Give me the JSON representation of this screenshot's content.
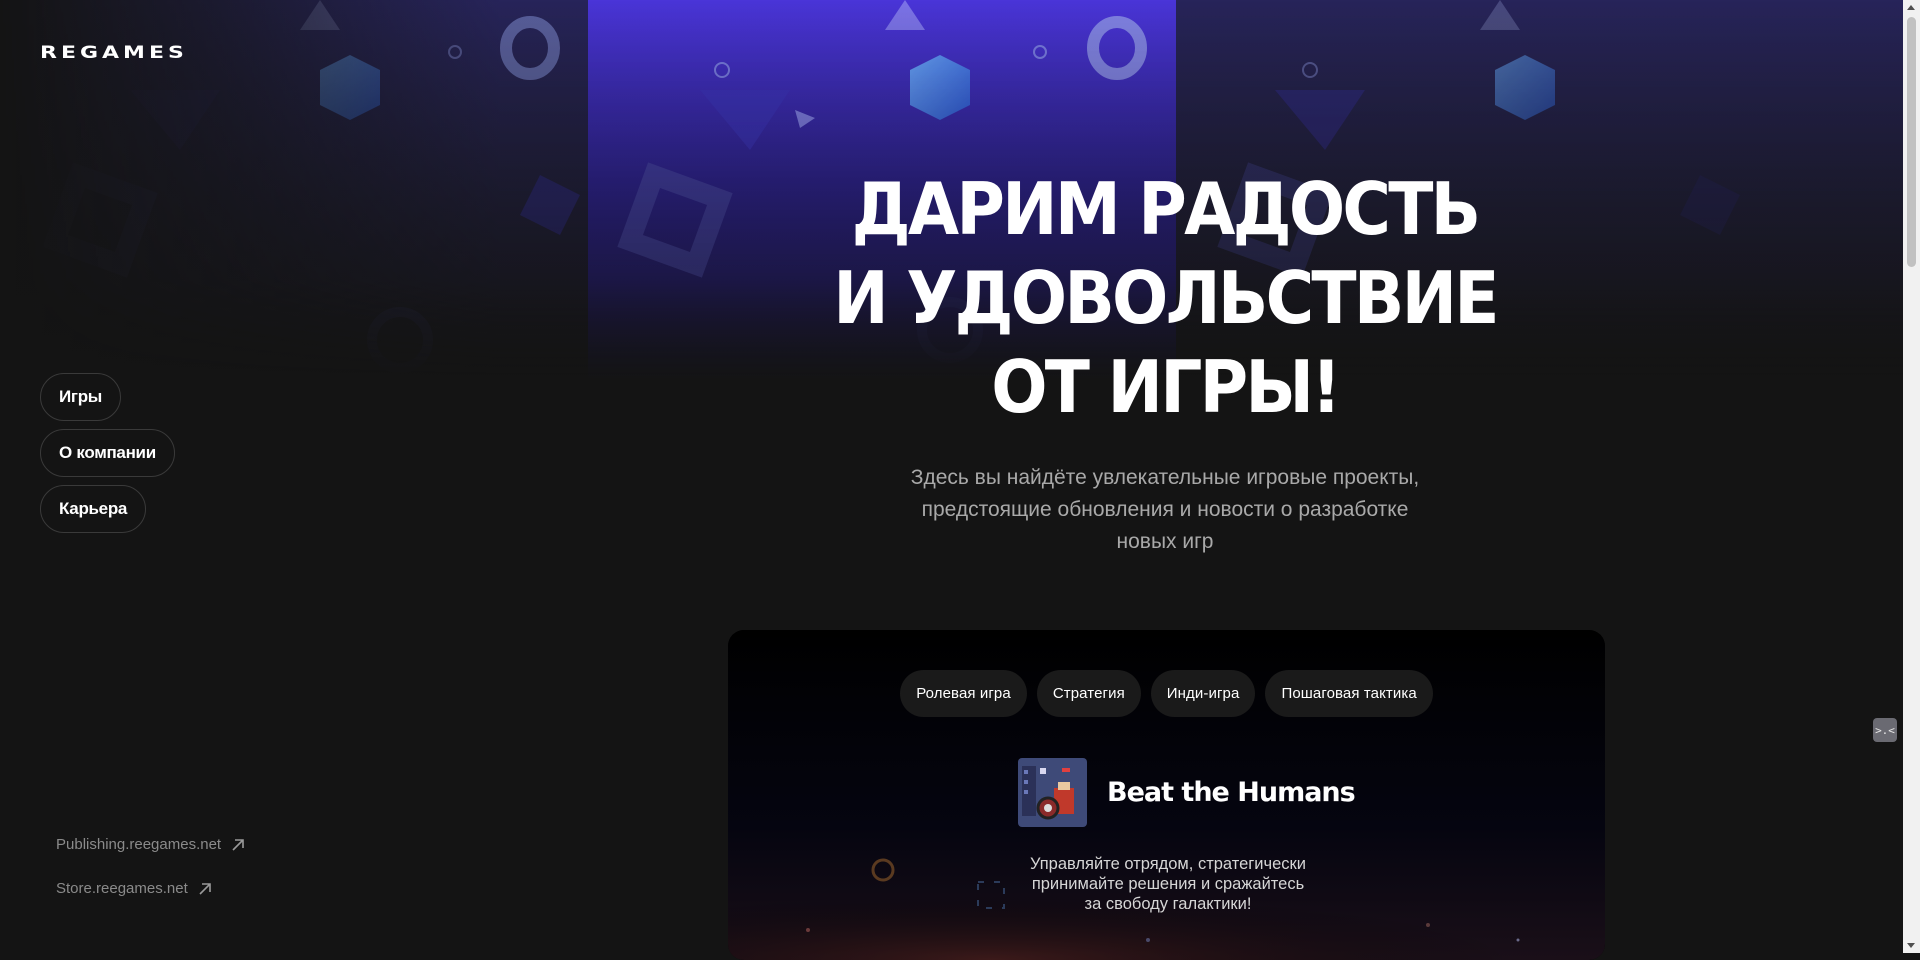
{
  "brand": {
    "logo_text": "REGAMES"
  },
  "nav": {
    "items": [
      {
        "label": "Игры"
      },
      {
        "label": "О компании"
      },
      {
        "label": "Карьера"
      }
    ]
  },
  "external_links": [
    {
      "label": "Publishing.reegames.net"
    },
    {
      "label": "Store.reegames.net"
    }
  ],
  "hero": {
    "title_lines": [
      "ДАРИМ РАДОСТЬ",
      "И УДОВОЛЬСТВИЕ",
      "ОТ ИГРЫ!"
    ],
    "subtitle_lines": [
      "Здесь вы найдёте увлекательные игровые проекты,",
      "предстоящие обновления и новости о разработке",
      "новых игр"
    ]
  },
  "game_card": {
    "tags": [
      "Ролевая игра",
      "Стратегия",
      "Инди-игра",
      "Пошаговая тактика"
    ],
    "title": "Beat the Humans",
    "description_lines": [
      "Управляйте отрядом, стратегически",
      "принимайте решения и сражайтесь",
      "за свободу галактики!"
    ]
  },
  "widget": {
    "icon": "extension-icon",
    "text": ">.<"
  },
  "colors": {
    "background": "#141414",
    "card": "#000000",
    "tag": "#1a1a1a",
    "accent": "#4a3fd6"
  }
}
